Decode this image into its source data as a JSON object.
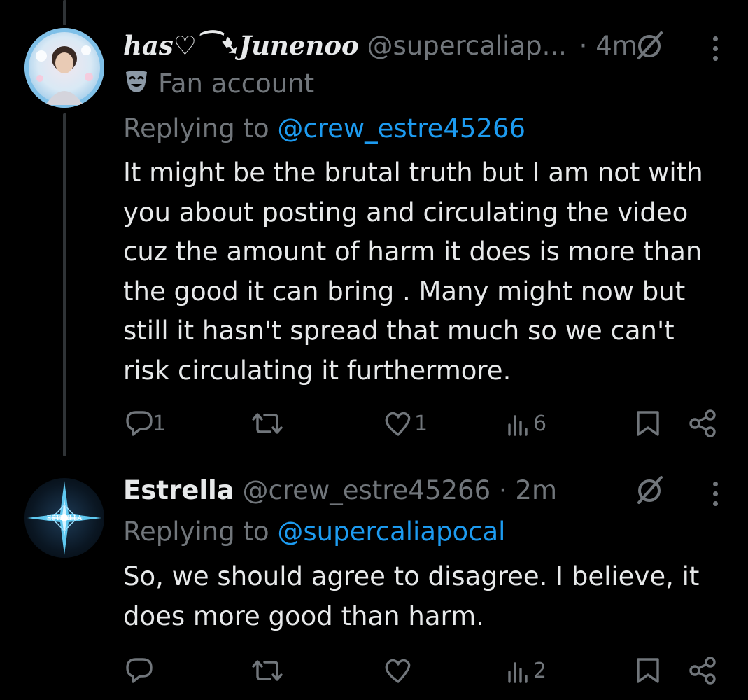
{
  "tweets": [
    {
      "display_name": "has♡⁀➷Junenoo",
      "handle": "@supercaliap...",
      "time": "· 4m",
      "label_icon": "mask-icon",
      "label": "Fan account",
      "replying_prefix": "Replying to",
      "replying_handle": "@crew_estre45266",
      "text": "It might be the brutal truth but I am not with\nyou about posting and circulating the video\ncuz the amount of harm it does is more than\nthe good it can bring . Many might now but\nstill it hasn't spread that much so we can't\nrisk circulating it furthermore.",
      "replies": "1",
      "retweets": "",
      "likes": "1",
      "views": "6"
    },
    {
      "display_name": "Estrella",
      "handle": "@crew_estre45266",
      "time": "· 2m",
      "replying_prefix": "Replying to",
      "replying_handle": "@supercaliapocal",
      "text": "So, we should agree to disagree. I believe, it\ndoes more good than harm.",
      "replies": "",
      "retweets": "",
      "likes": "",
      "views": "2"
    }
  ],
  "avatar2_text": "ESTRELLA",
  "colors": {
    "background": "#000000",
    "text": "#e7e9ea",
    "muted": "#71767b",
    "link": "#1d9bf0",
    "thread_line": "#2f3336"
  }
}
